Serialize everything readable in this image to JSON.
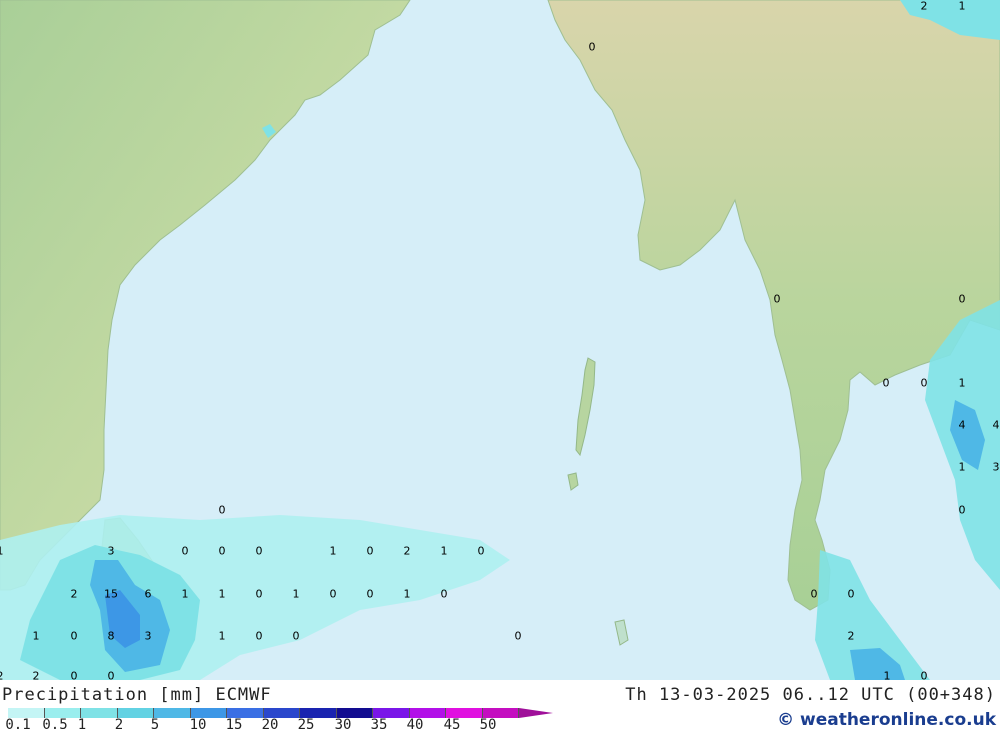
{
  "title": "Precipitation [mm] ECMWF",
  "datetime": "Th 13-03-2025 06..12 UTC (00+348)",
  "credit": "© weatheronline.co.uk",
  "legend": {
    "ticks": [
      "0.1",
      "0.5",
      "1",
      "2",
      "5",
      "10",
      "15",
      "20",
      "25",
      "30",
      "35",
      "40",
      "45",
      "50"
    ],
    "colors": [
      "#c4f5f5",
      "#9aeeee",
      "#7fe2e6",
      "#62d2e3",
      "#4fb8e6",
      "#3d97e6",
      "#3a6fe4",
      "#2a47cc",
      "#1a24b0",
      "#120c90",
      "#7a16e8",
      "#b210e8",
      "#e010e0",
      "#c40ec0",
      "#a0109a"
    ]
  },
  "map_values": [
    "2",
    "1",
    "0",
    "0",
    "0",
    "0",
    "1",
    "0",
    "4",
    "4",
    "1",
    "3",
    "0",
    "1",
    "3",
    "0",
    "0",
    "0",
    "0",
    "1",
    "0",
    "2",
    "1",
    "0",
    "2",
    "15",
    "6",
    "1",
    "1",
    "0",
    "1",
    "0",
    "0",
    "1",
    "0",
    "0",
    "0",
    "1",
    "0",
    "8",
    "3",
    "1",
    "0",
    "0",
    "0",
    "2",
    "2",
    "2",
    "1",
    "0",
    "0",
    "0"
  ]
}
